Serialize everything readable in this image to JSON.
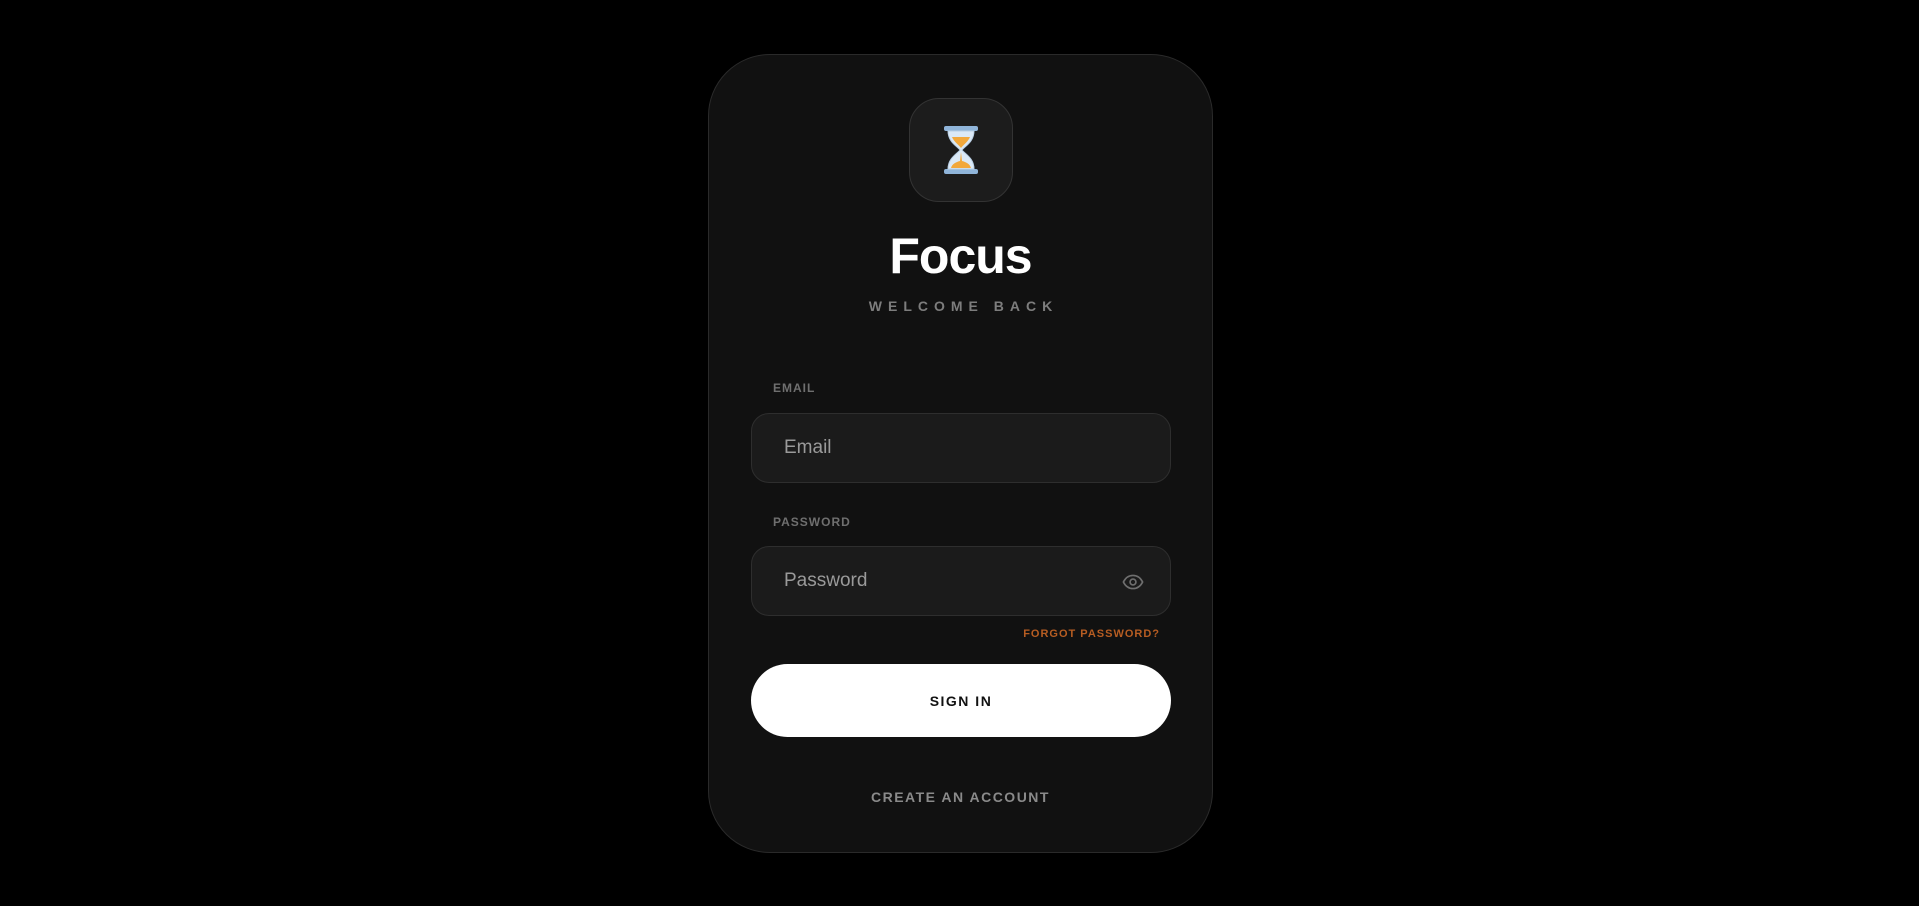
{
  "app": {
    "title": "Focus",
    "subtitle": "WELCOME BACK",
    "logo_icon": "hourglass-icon"
  },
  "form": {
    "email": {
      "label": "EMAIL",
      "placeholder": "Email",
      "value": ""
    },
    "password": {
      "label": "PASSWORD",
      "placeholder": "Password",
      "value": "",
      "toggle_icon": "eye-icon"
    },
    "forgot_password_label": "FORGOT PASSWORD?",
    "sign_in_label": "SIGN IN",
    "create_account_label": "CREATE AN ACCOUNT"
  },
  "colors": {
    "background": "#000000",
    "card": "#111111",
    "field": "#1b1b1b",
    "accent": "#b75d22",
    "button": "#ffffff"
  }
}
